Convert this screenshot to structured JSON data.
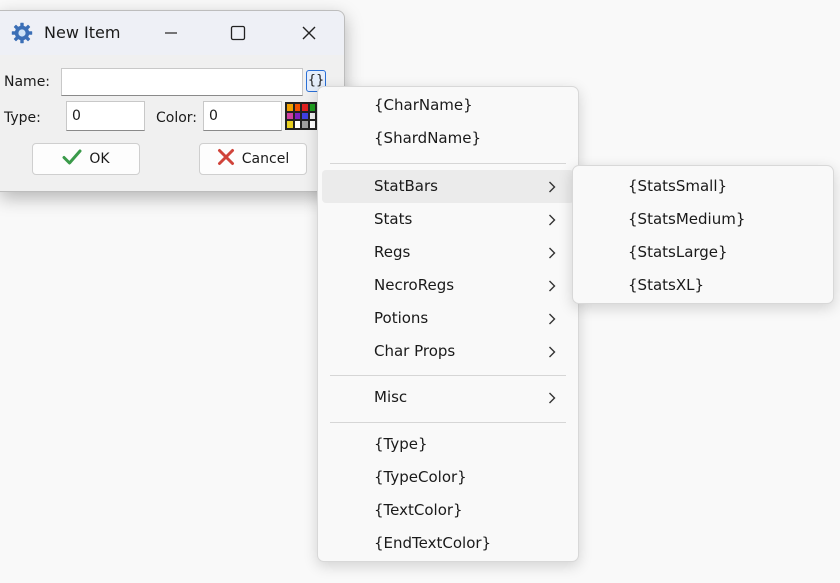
{
  "window": {
    "title": "New Item",
    "controls": {
      "minimize": "minimize-icon",
      "maximize": "maximize-icon",
      "close": "close-icon"
    }
  },
  "form": {
    "name_label": "Name:",
    "name_value": "",
    "variables_button": "{}",
    "type_label": "Type:",
    "type_value": "0",
    "color_label": "Color:",
    "color_value": "0",
    "palette_colors": [
      "#f0a000",
      "#f05000",
      "#e02020",
      "#20a020",
      "#d040a0",
      "#8020c0",
      "#4040e0",
      "#f0f0f0",
      "#e8d020",
      "#ffffff",
      "#a0a0a0",
      "#ffffff"
    ]
  },
  "buttons": {
    "ok": "OK",
    "cancel": "Cancel"
  },
  "menu": {
    "group1": [
      "{CharName}",
      "{ShardName}"
    ],
    "submenus": [
      "StatBars",
      "Stats",
      "Regs",
      "NecroRegs",
      "Potions",
      "Char Props"
    ],
    "misc": "Misc",
    "group3": [
      "{Type}",
      "{TypeColor}",
      "{TextColor}",
      "{EndTextColor}"
    ],
    "highlighted": "StatBars"
  },
  "submenu_statbars": [
    "{StatsSmall}",
    "{StatsMedium}",
    "{StatsLarge}",
    "{StatsXL}"
  ],
  "colors": {
    "accent": "#2a6fd6",
    "ok_check": "#3a9a4a",
    "cancel_x": "#d0433a"
  }
}
